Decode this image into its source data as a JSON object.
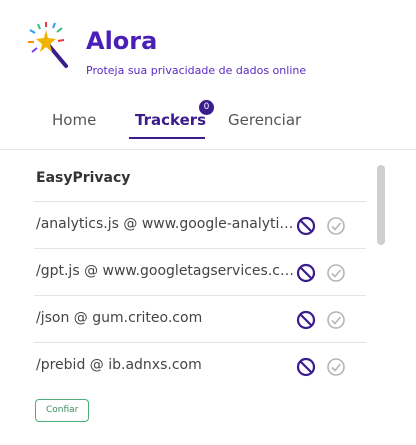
{
  "app": {
    "title": "Alora",
    "subtitle": "Proteja sua privacidade de dados online",
    "logo_icon": "magic-wand-icon"
  },
  "tabs": {
    "home": "Home",
    "trackers": "Trackers",
    "manage": "Gerenciar",
    "active": "trackers",
    "trackers_badge": "0"
  },
  "list": {
    "heading": "EasyPrivacy",
    "items": [
      {
        "name": "/analytics.js @ www.google-analytics.com",
        "block_icon": "block-icon",
        "allow_icon": "check-circle-icon"
      },
      {
        "name": "/gpt.js @ www.googletagservices.com",
        "block_icon": "block-icon",
        "allow_icon": "check-circle-icon"
      },
      {
        "name": "/json @ gum.criteo.com",
        "block_icon": "block-icon",
        "allow_icon": "check-circle-icon"
      },
      {
        "name": "/prebid @ ib.adnxs.com",
        "block_icon": "block-icon",
        "allow_icon": "check-circle-icon"
      }
    ],
    "trust_button_label": "Confiar"
  },
  "colors": {
    "brand": "#4a1fb8",
    "tab_active": "#3b1c8c",
    "block": "#3b1c8c",
    "allow": "#b5b5b5",
    "trust_border": "#4caf7a"
  }
}
